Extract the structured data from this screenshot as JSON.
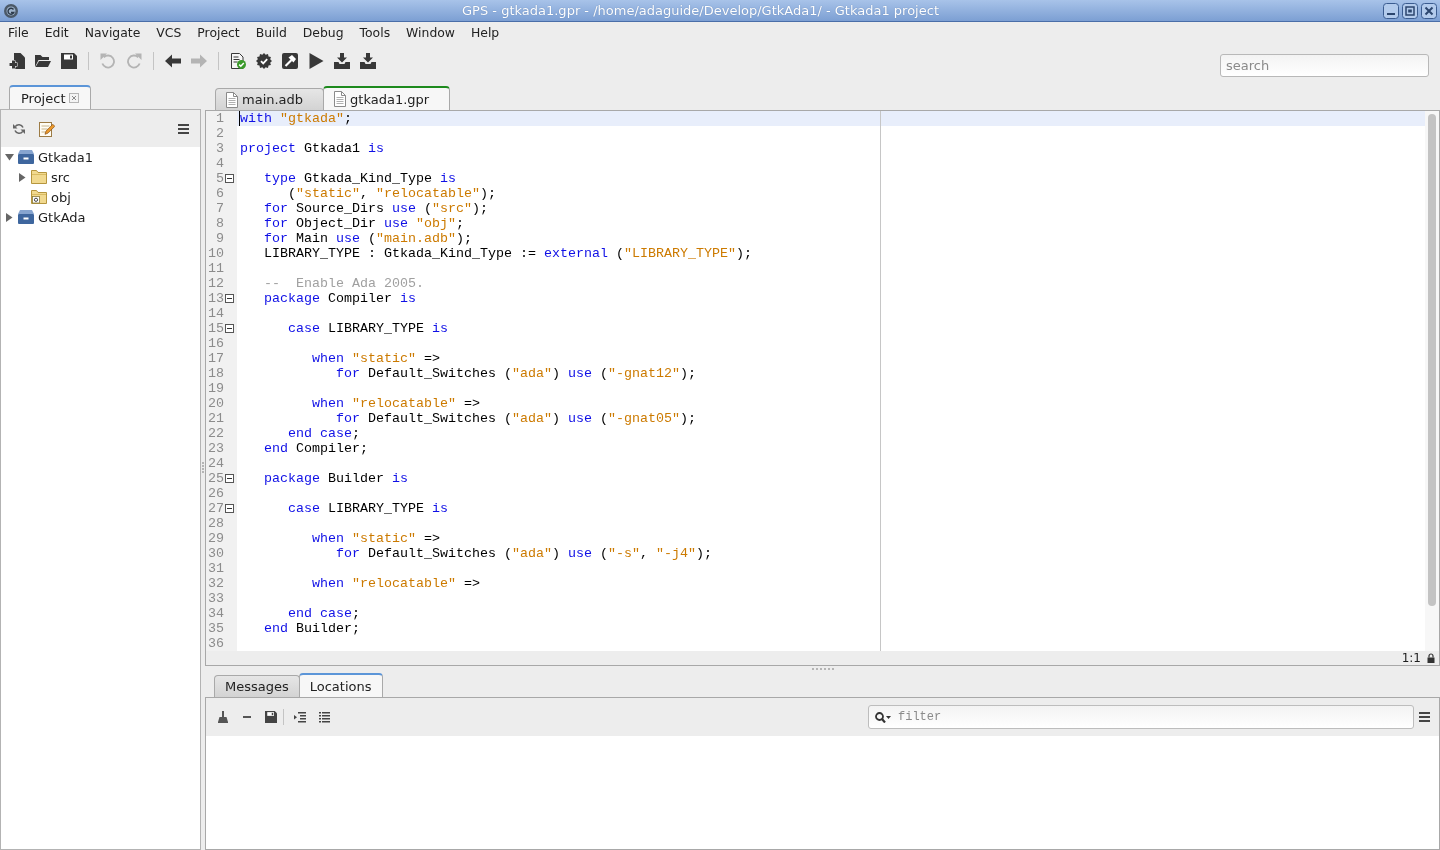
{
  "window": {
    "title": "GPS - gtkada1.gpr - /home/adaguide/Develop/GtkAda1/ - Gtkada1 project"
  },
  "menu_bar": {
    "items": [
      "File",
      "Edit",
      "Navigate",
      "VCS",
      "Project",
      "Build",
      "Debug",
      "Tools",
      "Window",
      "Help"
    ]
  },
  "toolbar": {
    "groups": [
      {
        "buttons": [
          {
            "disabled": false
          },
          {
            "disabled": false
          },
          {
            "disabled": false
          }
        ]
      },
      {
        "buttons": [
          {
            "disabled": true
          },
          {
            "disabled": true
          }
        ]
      },
      {
        "buttons": [
          {
            "disabled": false
          },
          {
            "disabled": true
          }
        ]
      },
      {
        "buttons": [
          {
            "disabled": false
          },
          {
            "disabled": false
          },
          {
            "disabled": false
          },
          {
            "disabled": false
          },
          {
            "disabled": false
          },
          {
            "disabled": false
          }
        ]
      }
    ],
    "search": {
      "placeholder": "search"
    }
  },
  "project_view": {
    "tabs": [
      {
        "label": "Project",
        "selected": true
      }
    ],
    "tree": [
      {
        "label": "Gtkada1",
        "kind": "project",
        "expanded": true,
        "children": [
          {
            "label": "src",
            "kind": "folder",
            "expanded": false
          },
          {
            "label": "obj",
            "kind": "object_folder"
          }
        ]
      },
      {
        "label": "GtkAda",
        "kind": "project",
        "expanded": false
      }
    ]
  },
  "editor": {
    "tabs": [
      {
        "label": "main.adb",
        "selected": false
      },
      {
        "label": "gtkada1.gpr",
        "selected": true
      }
    ],
    "lines": [
      {
        "number": "1",
        "collapsible": false,
        "current": true,
        "tokens": [
          {
            "kind": "keyword",
            "text": "with"
          },
          {
            "kind": "string",
            "text": " \"gtkada\""
          },
          {
            "kind": "plain",
            "text": ";"
          }
        ]
      },
      {
        "number": "2",
        "collapsible": false,
        "current": false
      },
      {
        "number": "3",
        "collapsible": false,
        "current": false,
        "tokens": [
          {
            "kind": "keyword",
            "text": "project"
          },
          {
            "kind": "plain",
            "text": " Gtkada1 "
          },
          {
            "kind": "keyword",
            "text": "is"
          }
        ]
      },
      {
        "number": "4",
        "collapsible": false,
        "current": false
      },
      {
        "number": "5",
        "collapsible": true,
        "current": false,
        "tokens": [
          {
            "kind": "keyword",
            "text": "   type"
          },
          {
            "kind": "plain",
            "text": " Gtkada_Kind_Type "
          },
          {
            "kind": "keyword",
            "text": "is"
          }
        ]
      },
      {
        "number": "6",
        "collapsible": false,
        "current": false,
        "tokens": [
          {
            "kind": "plain",
            "text": "      ("
          },
          {
            "kind": "string",
            "text": "\"static\""
          },
          {
            "kind": "plain",
            "text": ", "
          },
          {
            "kind": "string",
            "text": "\"relocatable\""
          },
          {
            "kind": "plain",
            "text": ");"
          }
        ]
      },
      {
        "number": "7",
        "collapsible": false,
        "current": false,
        "tokens": [
          {
            "kind": "keyword",
            "text": "   for"
          },
          {
            "kind": "plain",
            "text": " Source_Dirs "
          },
          {
            "kind": "keyword",
            "text": "use"
          },
          {
            "kind": "plain",
            "text": " ("
          },
          {
            "kind": "string",
            "text": "\"src\""
          },
          {
            "kind": "plain",
            "text": ");"
          }
        ]
      },
      {
        "number": "8",
        "collapsible": false,
        "current": false,
        "tokens": [
          {
            "kind": "keyword",
            "text": "   for"
          },
          {
            "kind": "plain",
            "text": " Object_Dir "
          },
          {
            "kind": "keyword",
            "text": "use"
          },
          {
            "kind": "string",
            "text": " \"obj\""
          },
          {
            "kind": "plain",
            "text": ";"
          }
        ]
      },
      {
        "number": "9",
        "collapsible": false,
        "current": false,
        "tokens": [
          {
            "kind": "keyword",
            "text": "   for"
          },
          {
            "kind": "plain",
            "text": " Main "
          },
          {
            "kind": "keyword",
            "text": "use"
          },
          {
            "kind": "plain",
            "text": " ("
          },
          {
            "kind": "string",
            "text": "\"main.adb\""
          },
          {
            "kind": "plain",
            "text": ");"
          }
        ]
      },
      {
        "number": "10",
        "collapsible": false,
        "current": false,
        "tokens": [
          {
            "kind": "plain",
            "text": "   LIBRARY_TYPE : Gtkada_Kind_Type := "
          },
          {
            "kind": "keyword",
            "text": "external"
          },
          {
            "kind": "plain",
            "text": " ("
          },
          {
            "kind": "string",
            "text": "\"LIBRARY_TYPE\""
          },
          {
            "kind": "plain",
            "text": ");"
          }
        ]
      },
      {
        "number": "11",
        "collapsible": false,
        "current": false
      },
      {
        "number": "12",
        "collapsible": false,
        "current": false,
        "tokens": [
          {
            "kind": "comment",
            "text": "   --  Enable Ada 2005."
          }
        ]
      },
      {
        "number": "13",
        "collapsible": true,
        "current": false,
        "tokens": [
          {
            "kind": "keyword",
            "text": "   package"
          },
          {
            "kind": "plain",
            "text": " Compiler "
          },
          {
            "kind": "keyword",
            "text": "is"
          }
        ]
      },
      {
        "number": "14",
        "collapsible": false,
        "current": false
      },
      {
        "number": "15",
        "collapsible": true,
        "current": false,
        "tokens": [
          {
            "kind": "keyword",
            "text": "      case"
          },
          {
            "kind": "plain",
            "text": " LIBRARY_TYPE "
          },
          {
            "kind": "keyword",
            "text": "is"
          }
        ]
      },
      {
        "number": "16",
        "collapsible": false,
        "current": false
      },
      {
        "number": "17",
        "collapsible": false,
        "current": false,
        "tokens": [
          {
            "kind": "keyword",
            "text": "         when"
          },
          {
            "kind": "string",
            "text": " \"static\""
          },
          {
            "kind": "plain",
            "text": " =>"
          }
        ]
      },
      {
        "number": "18",
        "collapsible": false,
        "current": false,
        "tokens": [
          {
            "kind": "keyword",
            "text": "            for"
          },
          {
            "kind": "plain",
            "text": " Default_Switches ("
          },
          {
            "kind": "string",
            "text": "\"ada\""
          },
          {
            "kind": "plain",
            "text": ") "
          },
          {
            "kind": "keyword",
            "text": "use"
          },
          {
            "kind": "plain",
            "text": " ("
          },
          {
            "kind": "string",
            "text": "\"-gnat12\""
          },
          {
            "kind": "plain",
            "text": ");"
          }
        ]
      },
      {
        "number": "19",
        "collapsible": false,
        "current": false
      },
      {
        "number": "20",
        "collapsible": false,
        "current": false,
        "tokens": [
          {
            "kind": "keyword",
            "text": "         when"
          },
          {
            "kind": "string",
            "text": " \"relocatable\""
          },
          {
            "kind": "plain",
            "text": " =>"
          }
        ]
      },
      {
        "number": "21",
        "collapsible": false,
        "current": false,
        "tokens": [
          {
            "kind": "keyword",
            "text": "            for"
          },
          {
            "kind": "plain",
            "text": " Default_Switches ("
          },
          {
            "kind": "string",
            "text": "\"ada\""
          },
          {
            "kind": "plain",
            "text": ") "
          },
          {
            "kind": "keyword",
            "text": "use"
          },
          {
            "kind": "plain",
            "text": " ("
          },
          {
            "kind": "string",
            "text": "\"-gnat05\""
          },
          {
            "kind": "plain",
            "text": ");"
          }
        ]
      },
      {
        "number": "22",
        "collapsible": false,
        "current": false,
        "tokens": [
          {
            "kind": "keyword",
            "text": "      end case"
          },
          {
            "kind": "plain",
            "text": ";"
          }
        ]
      },
      {
        "number": "23",
        "collapsible": false,
        "current": false,
        "tokens": [
          {
            "kind": "keyword",
            "text": "   end"
          },
          {
            "kind": "plain",
            "text": " Compiler;"
          }
        ]
      },
      {
        "number": "24",
        "collapsible": false,
        "current": false
      },
      {
        "number": "25",
        "collapsible": true,
        "current": false,
        "tokens": [
          {
            "kind": "keyword",
            "text": "   package"
          },
          {
            "kind": "plain",
            "text": " Builder "
          },
          {
            "kind": "keyword",
            "text": "is"
          }
        ]
      },
      {
        "number": "26",
        "collapsible": false,
        "current": false
      },
      {
        "number": "27",
        "collapsible": true,
        "current": false,
        "tokens": [
          {
            "kind": "keyword",
            "text": "      case"
          },
          {
            "kind": "plain",
            "text": " LIBRARY_TYPE "
          },
          {
            "kind": "keyword",
            "text": "is"
          }
        ]
      },
      {
        "number": "28",
        "collapsible": false,
        "current": false
      },
      {
        "number": "29",
        "collapsible": false,
        "current": false,
        "tokens": [
          {
            "kind": "keyword",
            "text": "         when"
          },
          {
            "kind": "string",
            "text": " \"static\""
          },
          {
            "kind": "plain",
            "text": " =>"
          }
        ]
      },
      {
        "number": "30",
        "collapsible": false,
        "current": false,
        "tokens": [
          {
            "kind": "keyword",
            "text": "            for"
          },
          {
            "kind": "plain",
            "text": " Default_Switches ("
          },
          {
            "kind": "string",
            "text": "\"ada\""
          },
          {
            "kind": "plain",
            "text": ") "
          },
          {
            "kind": "keyword",
            "text": "use"
          },
          {
            "kind": "plain",
            "text": " ("
          },
          {
            "kind": "string",
            "text": "\"-s\""
          },
          {
            "kind": "plain",
            "text": ", "
          },
          {
            "kind": "string",
            "text": "\"-j4\""
          },
          {
            "kind": "plain",
            "text": ");"
          }
        ]
      },
      {
        "number": "31",
        "collapsible": false,
        "current": false
      },
      {
        "number": "32",
        "collapsible": false,
        "current": false,
        "tokens": [
          {
            "kind": "keyword",
            "text": "         when"
          },
          {
            "kind": "string",
            "text": " \"relocatable\""
          },
          {
            "kind": "plain",
            "text": " =>"
          }
        ]
      },
      {
        "number": "33",
        "collapsible": false,
        "current": false
      },
      {
        "number": "34",
        "collapsible": false,
        "current": false,
        "tokens": [
          {
            "kind": "keyword",
            "text": "      end case"
          },
          {
            "kind": "plain",
            "text": ";"
          }
        ]
      },
      {
        "number": "35",
        "collapsible": false,
        "current": false,
        "tokens": [
          {
            "kind": "keyword",
            "text": "   end"
          },
          {
            "kind": "plain",
            "text": " Builder;"
          }
        ]
      },
      {
        "number": "36",
        "collapsible": false,
        "current": false
      }
    ],
    "status": {
      "position": "1:1"
    }
  },
  "bottom_panel": {
    "tabs": [
      {
        "label": "Messages",
        "selected": false
      },
      {
        "label": "Locations",
        "selected": true
      }
    ],
    "filter": {
      "placeholder": "filter"
    }
  }
}
